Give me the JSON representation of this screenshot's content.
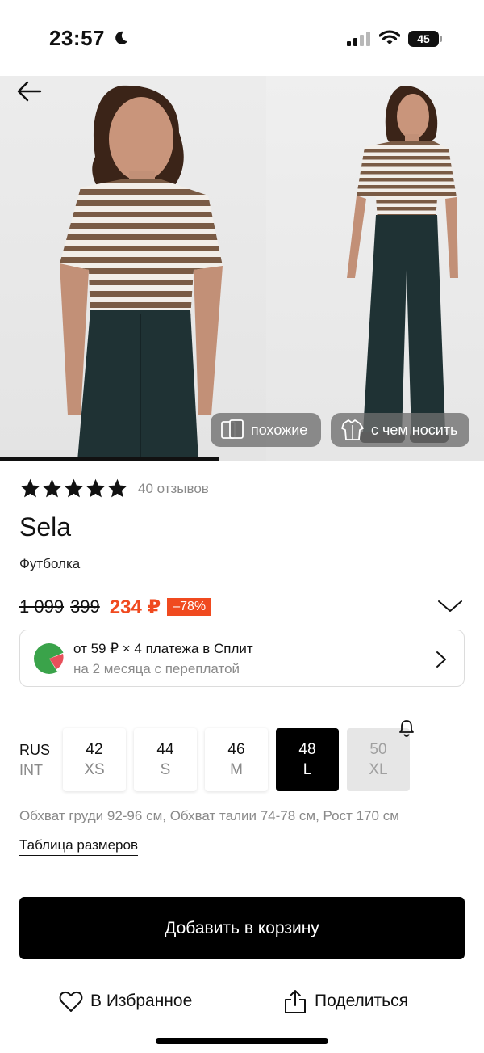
{
  "status_bar": {
    "time": "23:57",
    "battery": "45"
  },
  "gallery": {
    "similar_label": "похожие",
    "wear_with_label": "с чем носить",
    "icons": [
      "back-arrow-icon",
      "cards-icon",
      "outfit-icon"
    ]
  },
  "product": {
    "rating_stars": 5,
    "reviews": "40 отзывов",
    "brand": "Sela",
    "category": "Футболка",
    "old_price_1": "1 099",
    "old_price_2": "399",
    "price": "234 ₽",
    "discount": "–78%",
    "colors": {
      "price": "#f04a1f",
      "text": "#111111",
      "muted": "#8a8a8a"
    }
  },
  "split": {
    "line1": "от 59 ₽ × 4 платежа в Сплит",
    "line2": "на 2 месяца с переплатой"
  },
  "sizes": {
    "label_rus": "RUS",
    "label_int": "INT",
    "items": [
      {
        "rus": "42",
        "int": "XS",
        "state": "available"
      },
      {
        "rus": "44",
        "int": "S",
        "state": "available"
      },
      {
        "rus": "46",
        "int": "M",
        "state": "available"
      },
      {
        "rus": "48",
        "int": "L",
        "state": "selected"
      },
      {
        "rus": "50",
        "int": "XL",
        "state": "unavailable"
      }
    ],
    "measurements": "Обхват груди 92-96 см, Обхват талии 74-78 см, Рост 170 см",
    "size_table_link": "Таблица размеров"
  },
  "actions": {
    "add_to_cart": "Добавить в корзину",
    "favorite": "В Избранное",
    "share": "Поделиться"
  }
}
